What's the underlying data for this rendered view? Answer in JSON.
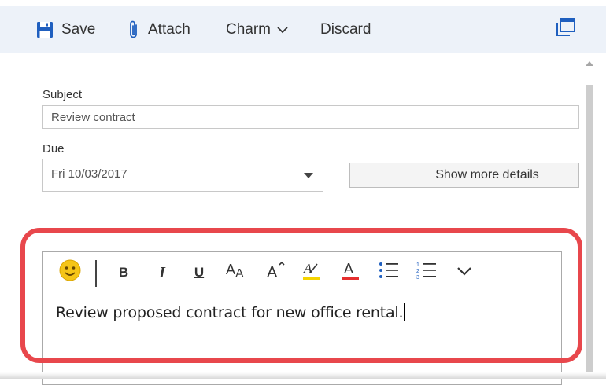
{
  "toolbar": {
    "save_label": "Save",
    "attach_label": "Attach",
    "charm_label": "Charm",
    "discard_label": "Discard"
  },
  "form": {
    "subject_label": "Subject",
    "subject_value": "Review contract",
    "due_label": "Due",
    "due_value": "Fri 10/03/2017",
    "more_details_label": "Show more details"
  },
  "editor": {
    "format_buttons": {
      "bold": "B",
      "italic": "I",
      "underline": "U"
    },
    "body_text": "Review proposed contract for new office rental."
  },
  "colors": {
    "toolbar_bg": "#edf2f9",
    "accent_blue": "#1f5fbf",
    "highlight_red": "#e8474c"
  },
  "icons": [
    "save-icon",
    "paperclip-icon",
    "chevron-down-icon",
    "popout-icon",
    "emoji-icon",
    "font-size-icon",
    "grow-font-icon",
    "highlight-icon",
    "font-color-icon",
    "bullets-icon",
    "numbering-icon",
    "more-options-icon"
  ]
}
